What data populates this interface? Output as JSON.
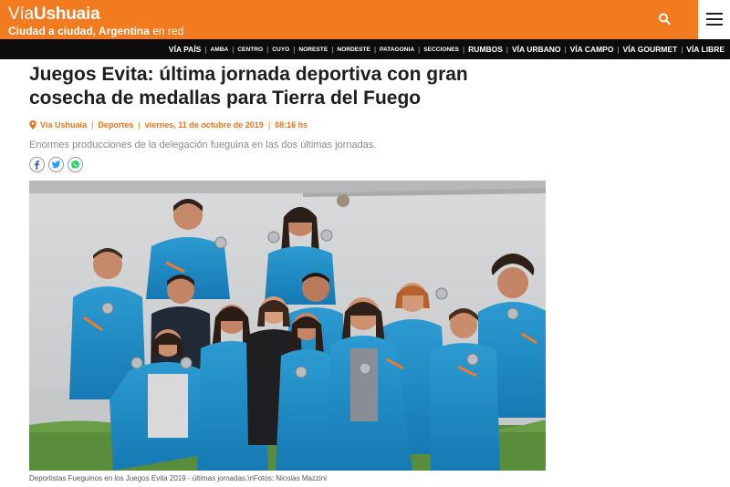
{
  "site": {
    "name_part1": "Vía",
    "name_part2": "Ushuaia",
    "tagline_bold": "Ciudad a ciudad, Argentina",
    "tagline_end": " en red",
    "colors": {
      "brand_orange": "#f37b1f",
      "nav_bg": "#0c0c0c",
      "accent_text": "#e8741d"
    }
  },
  "header": {
    "search_icon": "search-icon",
    "menu_icon": "hamburger-menu-icon"
  },
  "nav": {
    "items": [
      {
        "label": "VÍA PAÍS",
        "size": "big"
      },
      {
        "label": "AMBA",
        "size": "small"
      },
      {
        "label": "CENTRO",
        "size": "small"
      },
      {
        "label": "CUYO",
        "size": "small"
      },
      {
        "label": "NORESTE",
        "size": "small"
      },
      {
        "label": "NORDESTE",
        "size": "small"
      },
      {
        "label": "PATAGONIA",
        "size": "small"
      },
      {
        "label": "SECCIONES",
        "size": "small"
      },
      {
        "label": "RUMBOS",
        "size": "big"
      },
      {
        "label": "VÍA URBANO",
        "size": "big"
      },
      {
        "label": "VÍA CAMPO",
        "size": "big"
      },
      {
        "label": "VÍA GOURMET",
        "size": "big"
      },
      {
        "label": "VÍA LIBRE",
        "size": "big"
      }
    ]
  },
  "article": {
    "headline": "Juegos Evita: última jornada deportiva con gran cosecha de medallas para Tierra del Fuego",
    "meta": {
      "source": "Vía Ushuaia",
      "section": "Deportes",
      "date": "viernes, 11 de octubre de 2019",
      "time": "08:16 hs"
    },
    "subtitle": "Enormes producciones de la delegación fueguina en las dos últimas jornadas.",
    "share_icons": [
      "facebook-icon",
      "twitter-icon",
      "whatsapp-icon"
    ],
    "photo_caption": "Deportistas Fueguinos en los Juegos Evita 2019 - últimas jornadas.\\nFotos: Nicolas Mazzini"
  }
}
